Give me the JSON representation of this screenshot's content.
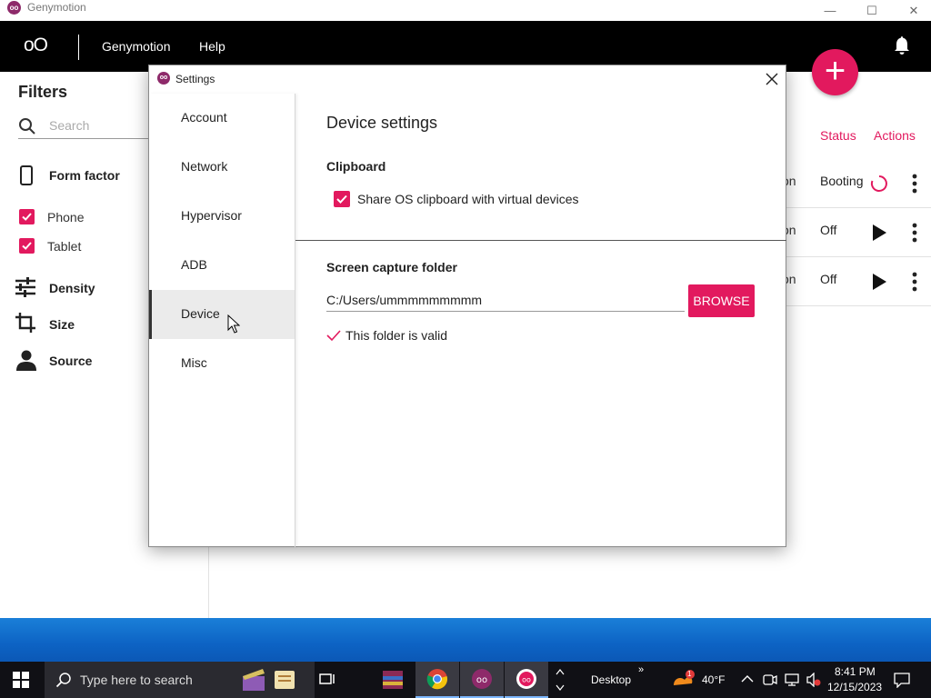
{
  "window": {
    "title": "Genymotion",
    "minimize": "—",
    "maximize": "☐",
    "close": "✕",
    "icon": "genymotion-logo"
  },
  "appbar": {
    "logo": "oO",
    "menu": [
      "Genymotion",
      "Help"
    ],
    "fab": "+",
    "bell_icon": "bell-icon"
  },
  "filters": {
    "title": "Filters",
    "search_placeholder": "Search",
    "form_factor": "Form factor",
    "checkboxes": [
      {
        "label": "Phone",
        "checked": true
      },
      {
        "label": "Tablet",
        "checked": true
      }
    ],
    "groups": [
      "Density",
      "Size",
      "Source"
    ]
  },
  "devices": {
    "columns": [
      "Status",
      "Actions"
    ],
    "rows": [
      {
        "trailing": "on",
        "status": "Booting",
        "action": "spinner"
      },
      {
        "trailing": "on",
        "status": "Off",
        "action": "play"
      },
      {
        "trailing": "on",
        "status": "Off",
        "action": "play"
      }
    ]
  },
  "settings": {
    "title": "Settings",
    "nav": [
      "Account",
      "Network",
      "Hypervisor",
      "ADB",
      "Device",
      "Misc"
    ],
    "active_nav": "Device",
    "heading": "Device settings",
    "clipboard": {
      "title": "Clipboard",
      "checkbox_label": "Share OS clipboard with virtual devices",
      "checked": true
    },
    "screen_capture": {
      "title": "Screen capture folder",
      "path": "C:/Users/ummmmmmmmm",
      "browse_label": "BROWSE",
      "validation": "This folder is valid"
    }
  },
  "taskbar": {
    "search_placeholder": "Type here to search",
    "desktop_label": "Desktop",
    "weather": "40°F",
    "weather_badge": "1",
    "time": "8:41 PM",
    "date": "12/15/2023"
  },
  "colors": {
    "accent": "#e2195e",
    "appbar": "#000000",
    "taskbar": "#101015"
  }
}
